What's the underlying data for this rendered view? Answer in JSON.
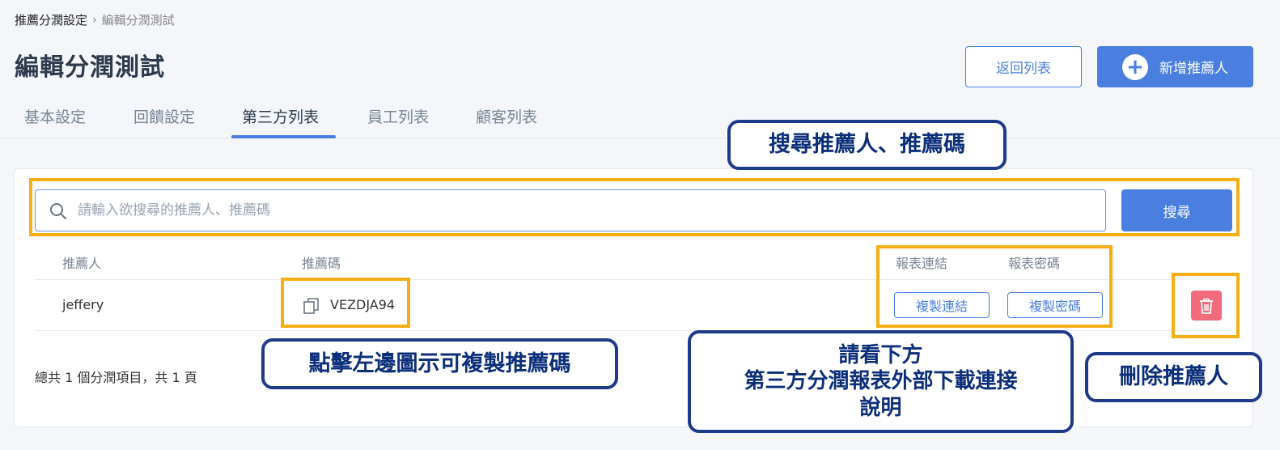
{
  "breadcrumb": {
    "parent": "推薦分潤設定",
    "separator": "›",
    "current": "編輯分潤測試"
  },
  "page_title": "編輯分潤測試",
  "header_buttons": {
    "back": "返回列表",
    "add": "新增推薦人",
    "add_icon": "plus-circle-icon"
  },
  "tabs": [
    {
      "label": "基本設定"
    },
    {
      "label": "回饋設定"
    },
    {
      "label": "第三方列表",
      "active": true
    },
    {
      "label": "員工列表"
    },
    {
      "label": "顧客列表"
    }
  ],
  "search": {
    "placeholder": "請輸入欲搜尋的推薦人、推薦碼",
    "value": "",
    "button": "搜尋"
  },
  "table": {
    "headers": {
      "referrer": "推薦人",
      "code": "推薦碼",
      "report_link": "報表連結",
      "report_password": "報表密碼"
    },
    "rows": [
      {
        "referrer": "jeffery",
        "code": "VEZDJA94",
        "copy_link": "複製連結",
        "copy_password": "複製密碼"
      }
    ]
  },
  "footer": {
    "summary": "總共 1 個分潤項目，共 1 頁"
  },
  "annotations": {
    "search": "搜尋推薦人、推薦碼",
    "copy_code": "點擊左邊圖示可複製推薦碼",
    "report_line1": "請看下方",
    "report_line2": "第三方分潤報表外部下載連接",
    "report_line3": "說明",
    "delete": "刪除推薦人"
  },
  "colors": {
    "primary": "#4a7fe0",
    "danger": "#f26b7a",
    "highlight": "#f6ae14",
    "callout_border": "#1e3a8a",
    "callout_text": "#0c2f7a"
  }
}
